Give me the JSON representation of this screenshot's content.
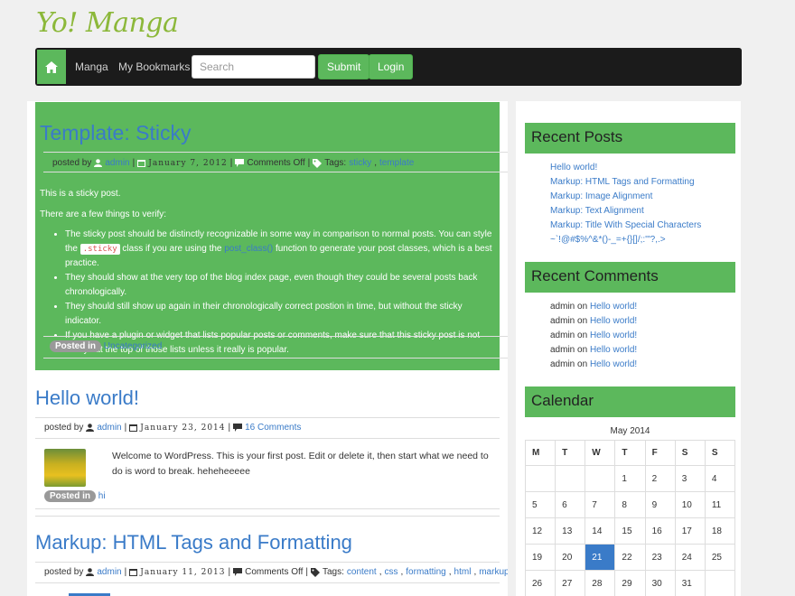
{
  "site": {
    "logo": "Yo! Manga"
  },
  "nav": {
    "items": [
      "Manga",
      "My Bookmarks"
    ],
    "search_placeholder": "Search",
    "submit_label": "Submit",
    "login_label": "Login"
  },
  "sticky_post": {
    "title": "Template: Sticky",
    "posted_by_label": "posted by",
    "author": "admin",
    "date": "January 7, 2012",
    "comments": "Comments Off",
    "tags_label": "Tags:",
    "tags": [
      "sticky",
      "template"
    ],
    "para1": "This is a sticky post.",
    "para2": "There are a few things to verify:",
    "bullets": {
      "b1_pre": "The sticky post should be distinctly recognizable in some way in comparison to normal posts. You can style the",
      "b1_code": ".sticky",
      "b1_mid": "class if you are using the",
      "b1_link": "post_class()",
      "b1_post": "function to generate your post classes, which is a best practice.",
      "b2": "They should show at the very top of the blog index page, even though they could be several posts back chronologically.",
      "b3": "They should still show up again in their chronologically correct postion in time, but without the sticky indicator.",
      "b4": "If you have a plugin or widget that lists popular posts or comments, make sure that this sticky post is not always at the top of those lists unless it really is popular."
    },
    "posted_in_label": "Posted in",
    "category": "Uncategorized"
  },
  "post2": {
    "title": "Hello world!",
    "posted_by_label": "posted by",
    "author": "admin",
    "date": "January 23, 2014",
    "comments": "16 Comments",
    "excerpt": "Welcome to WordPress. This is your first post. Edit or delete it, then start what we need to do is word to break. heheheeeee",
    "posted_in_label": "Posted in",
    "category": "hi"
  },
  "post3": {
    "title": "Markup: HTML Tags and Formatting",
    "posted_by_label": "posted by",
    "author": "admin",
    "date": "January 11, 2013",
    "comments": "Comments Off",
    "tags_label": "Tags:",
    "tags": [
      "content",
      "css",
      "formatting",
      "html",
      "markup"
    ]
  },
  "sidebar": {
    "recent_posts_title": "Recent Posts",
    "recent_posts": [
      "Hello world!",
      "Markup: HTML Tags and Formatting",
      "Markup: Image Alignment",
      "Markup: Text Alignment",
      "Markup: Title With Special Characters",
      "~`!@#$%^&*()-_=+{}[]/;:'\"?,.>"
    ],
    "recent_comments_title": "Recent Comments",
    "recent_comments": [
      {
        "author": "admin",
        "on": "on",
        "post": "Hello world!"
      },
      {
        "author": "admin",
        "on": "on",
        "post": "Hello world!"
      },
      {
        "author": "admin",
        "on": "on",
        "post": "Hello world!"
      },
      {
        "author": "admin",
        "on": "on",
        "post": "Hello world!"
      },
      {
        "author": "admin",
        "on": "on",
        "post": "Hello world!"
      }
    ],
    "calendar_title": "Calendar",
    "calendar": {
      "caption": "May 2014",
      "days": [
        "M",
        "T",
        "W",
        "T",
        "F",
        "S",
        "S"
      ],
      "weeks": [
        [
          "",
          "",
          "",
          "1",
          "2",
          "3",
          "4"
        ],
        [
          "5",
          "6",
          "7",
          "8",
          "9",
          "10",
          "11"
        ],
        [
          "12",
          "13",
          "14",
          "15",
          "16",
          "17",
          "18"
        ],
        [
          "19",
          "20",
          "21",
          "22",
          "23",
          "24",
          "25"
        ],
        [
          "26",
          "27",
          "28",
          "29",
          "30",
          "31",
          ""
        ]
      ],
      "today": "21"
    }
  },
  "colors": {
    "accent_green": "#5cb85c",
    "link_blue": "#3a7bc8",
    "navbar": "#1b1b1b",
    "logo": "#8cb83a"
  }
}
